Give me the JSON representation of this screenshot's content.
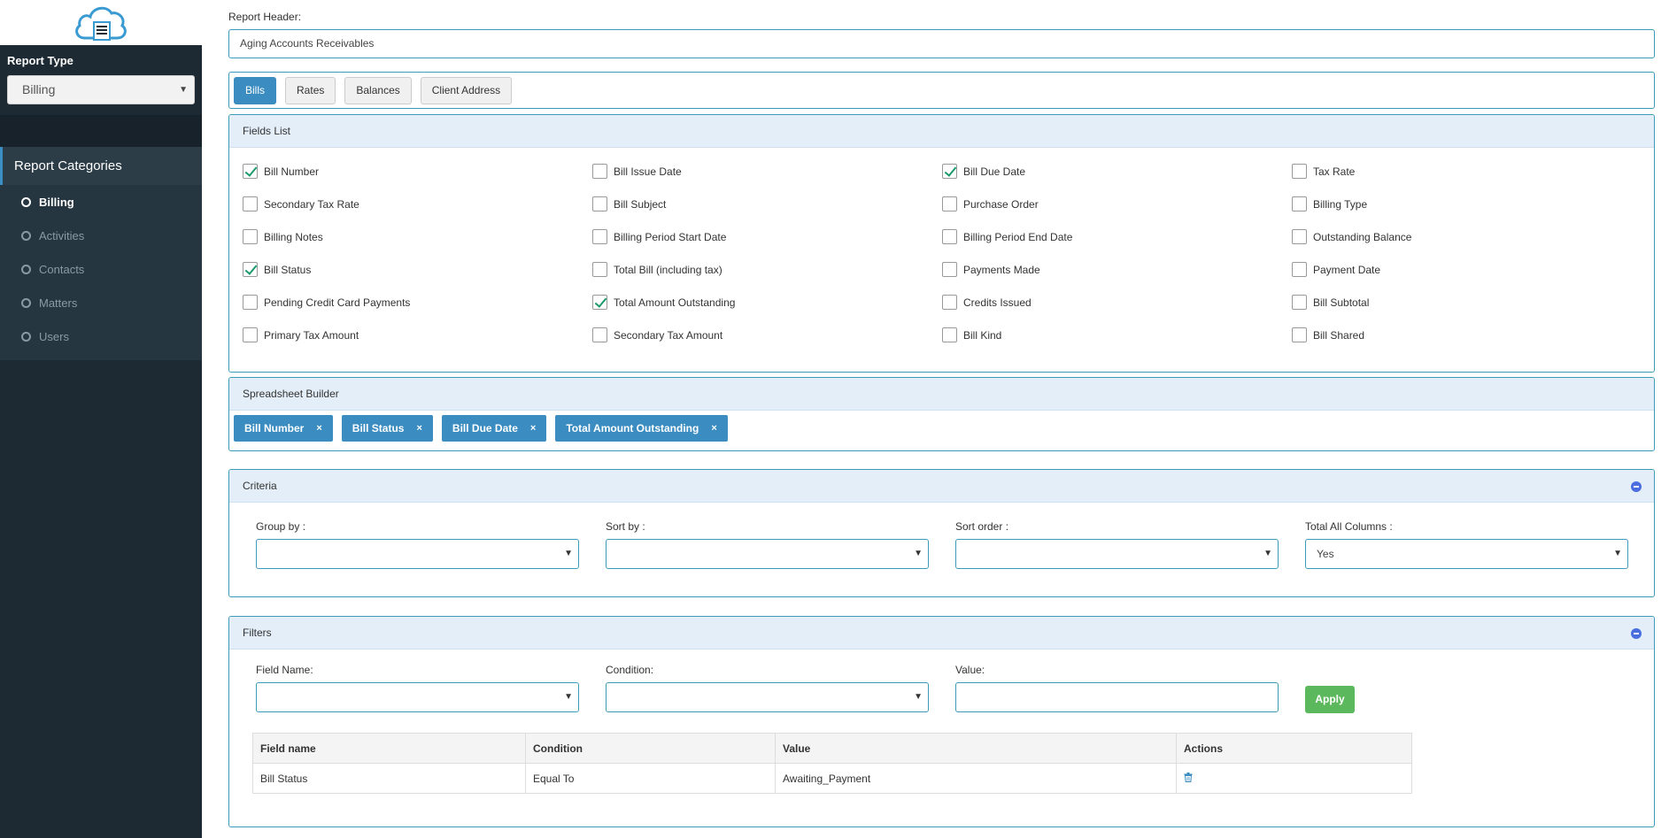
{
  "sidebar": {
    "report_type_label": "Report Type",
    "report_type_value": "Billing",
    "categories_header": "Report Categories",
    "categories": [
      {
        "label": "Billing",
        "active": true
      },
      {
        "label": "Activities",
        "active": false
      },
      {
        "label": "Contacts",
        "active": false
      },
      {
        "label": "Matters",
        "active": false
      },
      {
        "label": "Users",
        "active": false
      }
    ]
  },
  "header": {
    "label": "Report Header:",
    "value": "Aging Accounts Receivables"
  },
  "tabs": [
    "Bills",
    "Rates",
    "Balances",
    "Client Address"
  ],
  "fields_list": {
    "title": "Fields List",
    "fields": [
      {
        "label": "Bill Number",
        "checked": true
      },
      {
        "label": "Bill Issue Date",
        "checked": false
      },
      {
        "label": "Bill Due Date",
        "checked": true
      },
      {
        "label": "Tax Rate",
        "checked": false
      },
      {
        "label": "Secondary Tax Rate",
        "checked": false
      },
      {
        "label": "Bill Subject",
        "checked": false
      },
      {
        "label": "Purchase Order",
        "checked": false
      },
      {
        "label": "Billing Type",
        "checked": false
      },
      {
        "label": "Billing Notes",
        "checked": false
      },
      {
        "label": "Billing Period Start Date",
        "checked": false
      },
      {
        "label": "Billing Period End Date",
        "checked": false
      },
      {
        "label": "Outstanding Balance",
        "checked": false
      },
      {
        "label": "Bill Status",
        "checked": true
      },
      {
        "label": "Total Bill (including tax)",
        "checked": false
      },
      {
        "label": "Payments Made",
        "checked": false
      },
      {
        "label": "Payment Date",
        "checked": false
      },
      {
        "label": "Pending Credit Card Payments",
        "checked": false
      },
      {
        "label": "Total Amount Outstanding",
        "checked": true
      },
      {
        "label": "Credits Issued",
        "checked": false
      },
      {
        "label": "Bill Subtotal",
        "checked": false
      },
      {
        "label": "Primary Tax Amount",
        "checked": false
      },
      {
        "label": "Secondary Tax Amount",
        "checked": false
      },
      {
        "label": "Bill Kind",
        "checked": false
      },
      {
        "label": "Bill Shared",
        "checked": false
      }
    ]
  },
  "spreadsheet_builder": {
    "title": "Spreadsheet Builder",
    "chips": [
      "Bill Number",
      "Bill Status",
      "Bill Due Date",
      "Total Amount Outstanding"
    ],
    "remove_symbol": "×"
  },
  "criteria": {
    "title": "Criteria",
    "group_by_label": "Group by :",
    "group_by_value": "",
    "sort_by_label": "Sort by :",
    "sort_by_value": "",
    "sort_order_label": "Sort order :",
    "sort_order_value": "",
    "total_all_columns_label": "Total All Columns :",
    "total_all_columns_value": "Yes"
  },
  "filters": {
    "title": "Filters",
    "field_name_label": "Field Name:",
    "condition_label": "Condition:",
    "value_label": "Value:",
    "apply_label": "Apply",
    "table": {
      "headers": [
        "Field name",
        "Condition",
        "Value",
        "Actions"
      ],
      "rows": [
        {
          "field_name": "Bill Status",
          "condition": "Equal To",
          "value": "Awaiting_Payment",
          "action_icon": "trash-icon"
        }
      ]
    }
  },
  "colors": {
    "accent": "#3a8cc1",
    "apply_green": "#5cb85c",
    "sidebar_bg": "#1d2a33"
  }
}
